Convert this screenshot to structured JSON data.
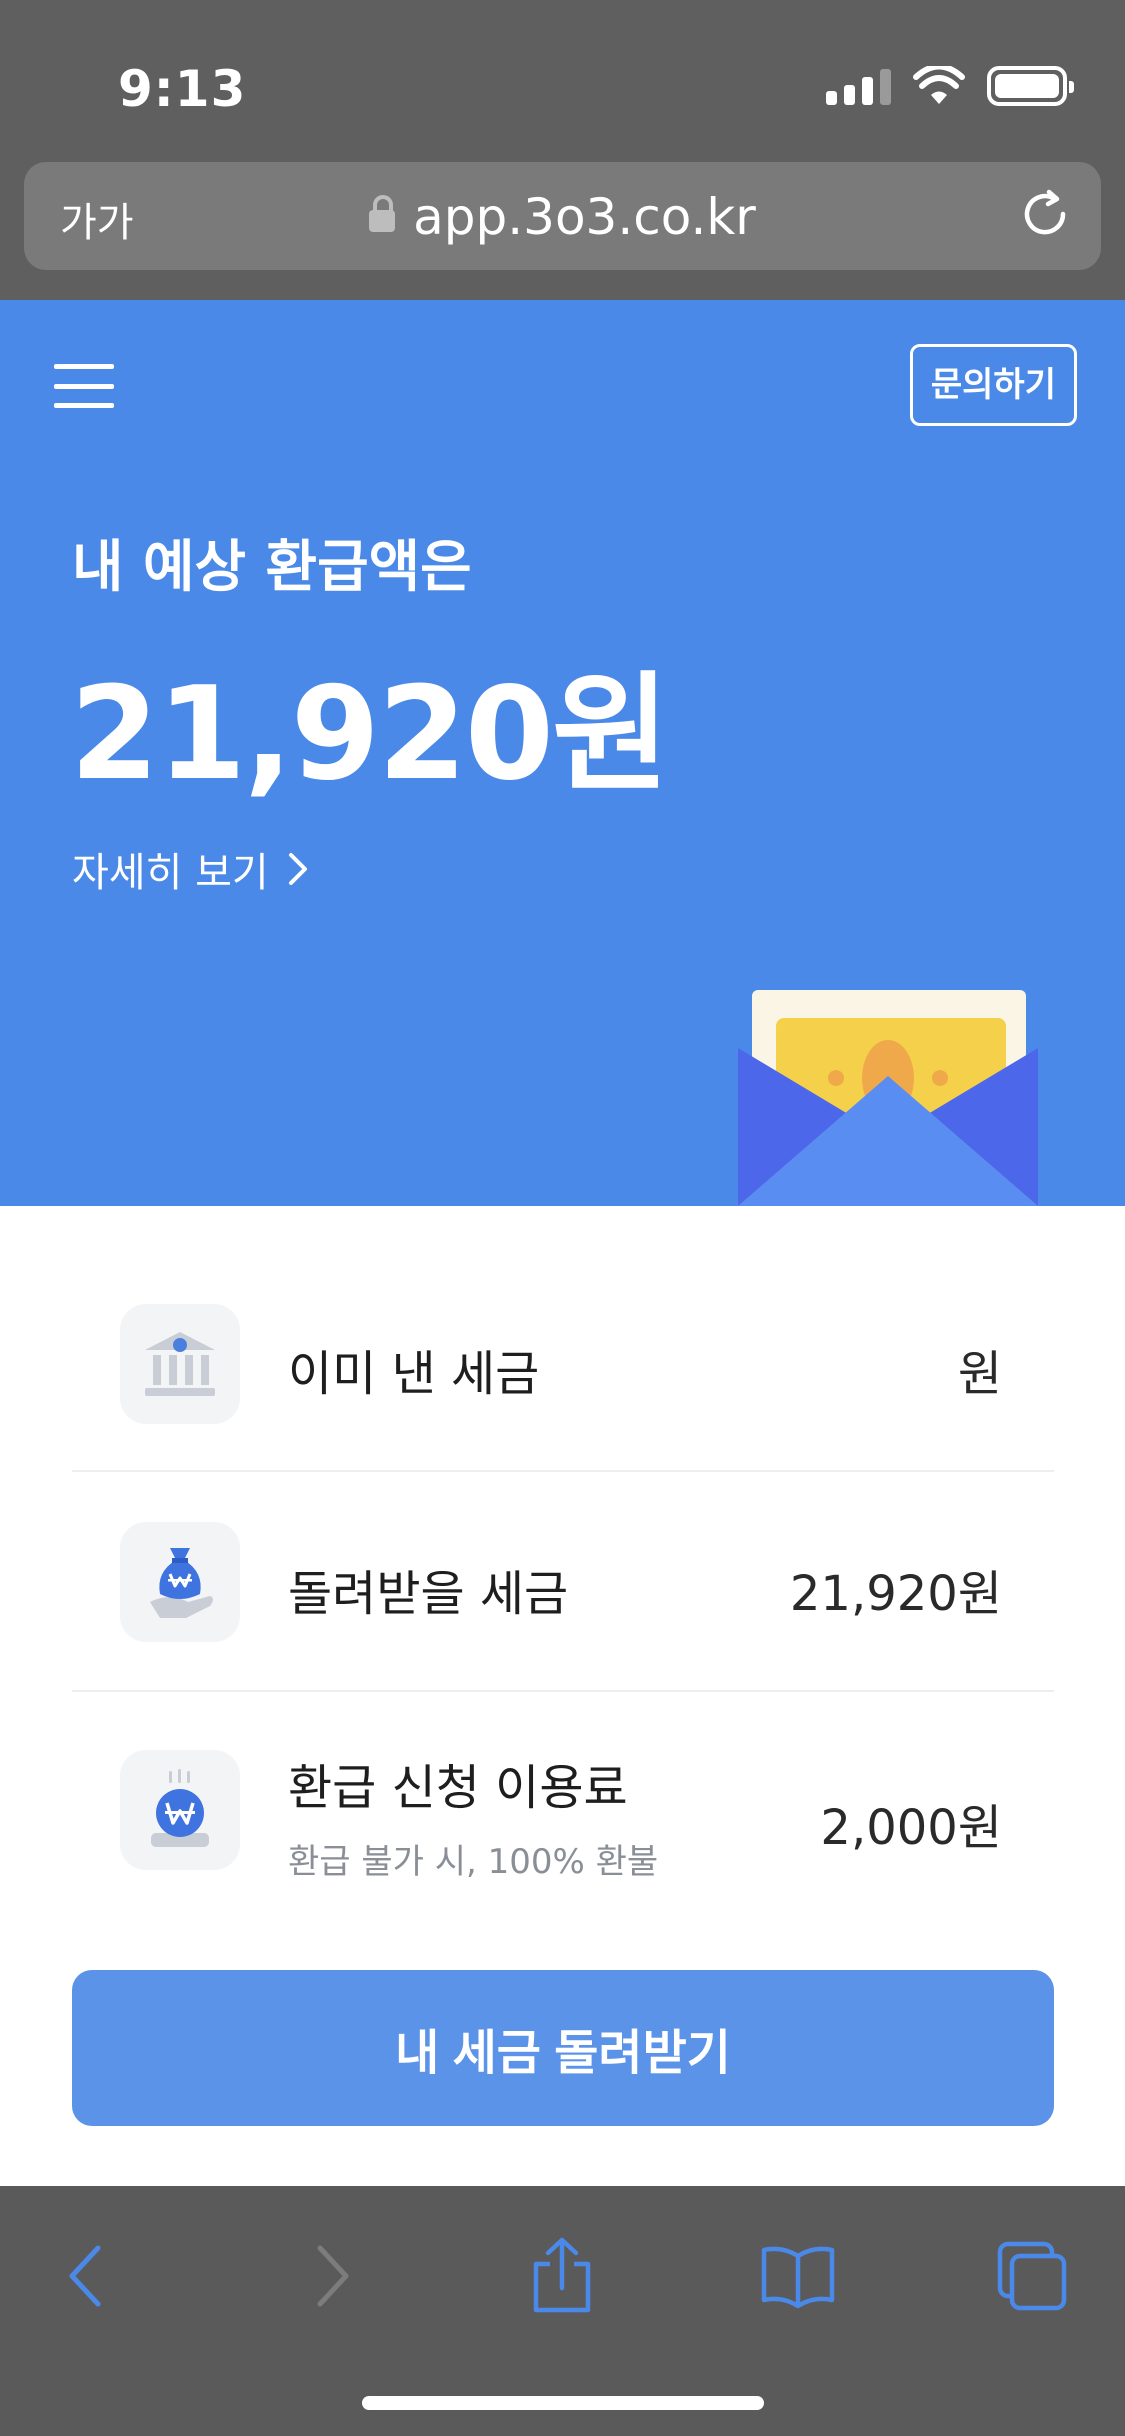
{
  "status_bar": {
    "time": "9:13"
  },
  "browser": {
    "text_size_label": "가가",
    "url": "app.3o3.co.kr"
  },
  "header": {
    "inquire_label": "문의하기"
  },
  "hero": {
    "label": "내 예상 환급액은",
    "amount": "21,920원",
    "detail_link": "자세히 보기"
  },
  "rows": [
    {
      "label": "이미 낸 세금",
      "value": "원",
      "sub": "",
      "icon": "bank-icon"
    },
    {
      "label": "돌려받을 세금",
      "value": "21,920원",
      "sub": "",
      "icon": "money-bag-icon"
    },
    {
      "label": "환급 신청 이용료",
      "value": "2,000원",
      "sub": "환급 불가 시, 100% 환불",
      "icon": "won-coin-icon"
    }
  ],
  "cta_label": "내 세금 돌려받기",
  "colors": {
    "hero_bg": "#4a89e8",
    "cta_bg": "#5b93e8",
    "toolbar_icon": "#4a89e8"
  }
}
